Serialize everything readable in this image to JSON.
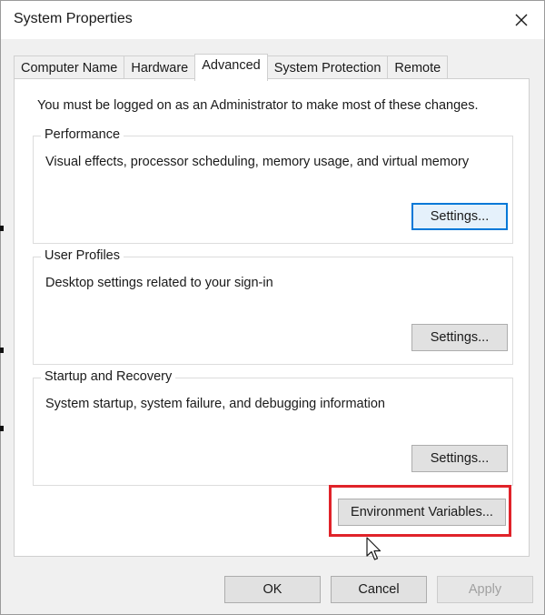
{
  "window": {
    "title": "System Properties"
  },
  "tabs": [
    {
      "label": "Computer Name"
    },
    {
      "label": "Hardware"
    },
    {
      "label": "Advanced"
    },
    {
      "label": "System Protection"
    },
    {
      "label": "Remote"
    }
  ],
  "active_tab": "Advanced",
  "notice": "You must be logged on as an Administrator to make most of these changes.",
  "groups": {
    "performance": {
      "label": "Performance",
      "description": "Visual effects, processor scheduling, memory usage, and virtual memory",
      "button": "Settings..."
    },
    "user_profiles": {
      "label": "User Profiles",
      "description": "Desktop settings related to your sign-in",
      "button": "Settings..."
    },
    "startup_recovery": {
      "label": "Startup and Recovery",
      "description": "System startup, system failure, and debugging information",
      "button": "Settings..."
    }
  },
  "environment_button": "Environment Variables...",
  "footer": {
    "ok": "OK",
    "cancel": "Cancel",
    "apply": "Apply"
  },
  "icons": {
    "close": "close-icon",
    "cursor": "mouse-pointer-icon"
  },
  "colors": {
    "highlight": "#e0232a",
    "focus": "#0078d7"
  }
}
